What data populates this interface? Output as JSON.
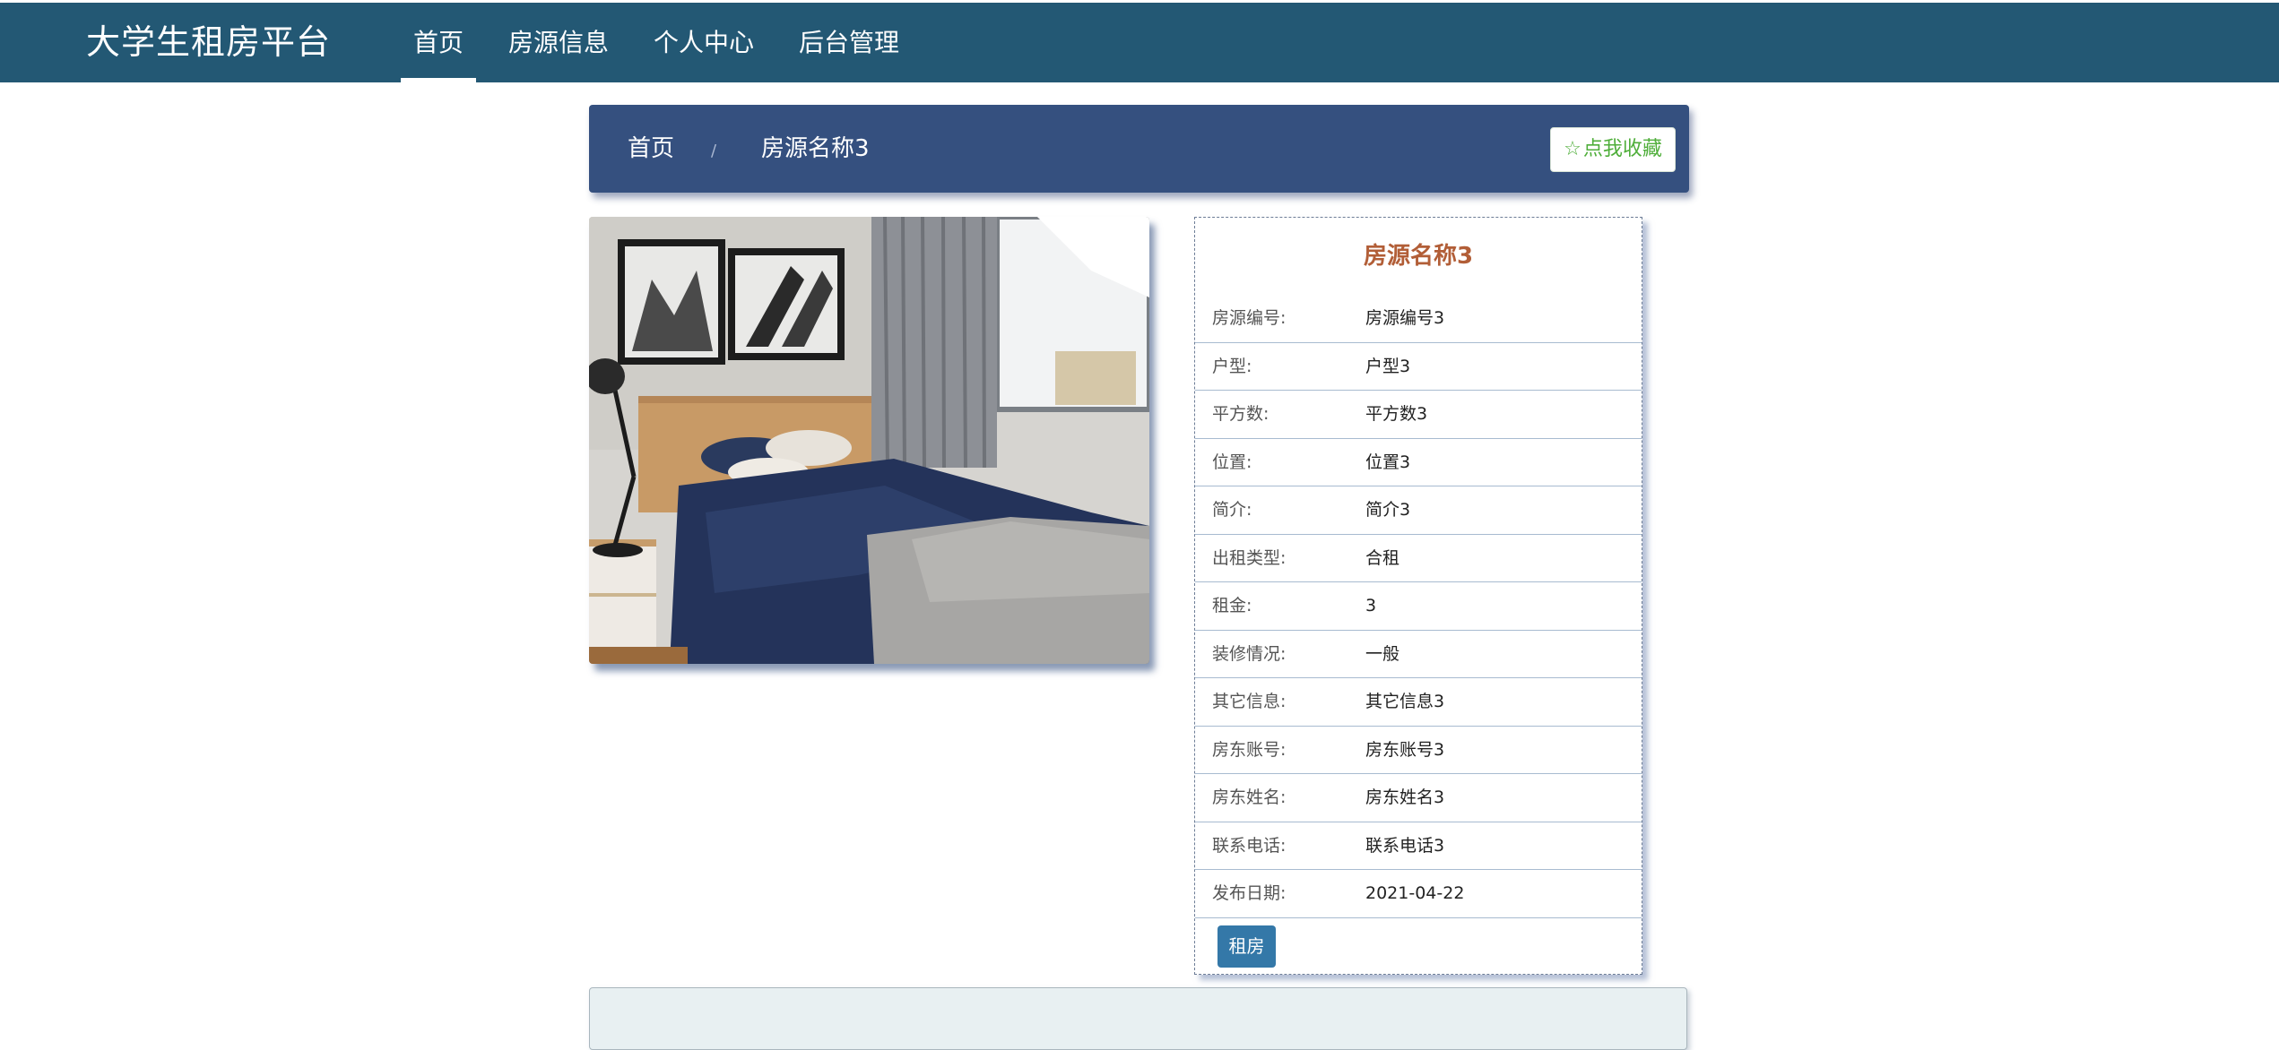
{
  "brand": "大学生租房平台",
  "nav": [
    {
      "label": "首页",
      "active": true
    },
    {
      "label": "房源信息",
      "active": false
    },
    {
      "label": "个人中心",
      "active": false
    },
    {
      "label": "后台管理",
      "active": false
    }
  ],
  "breadcrumb": {
    "home": "首页",
    "separator": "/",
    "current": "房源名称3"
  },
  "favorite_button": {
    "icon": "star-outline-icon",
    "label": "点我收藏"
  },
  "photo": {
    "description_icon": "bedroom-photo"
  },
  "detail": {
    "title": "房源名称3",
    "rows": [
      {
        "key": "房源编号:",
        "value": "房源编号3"
      },
      {
        "key": "户型:",
        "value": "户型3"
      },
      {
        "key": "平方数:",
        "value": "平方数3"
      },
      {
        "key": "位置:",
        "value": "位置3"
      },
      {
        "key": "简介:",
        "value": "简介3"
      },
      {
        "key": "出租类型:",
        "value": "合租"
      },
      {
        "key": "租金:",
        "value": "3"
      },
      {
        "key": "装修情况:",
        "value": "一般"
      },
      {
        "key": "其它信息:",
        "value": "其它信息3"
      },
      {
        "key": "房东账号:",
        "value": "房东账号3"
      },
      {
        "key": "房东姓名:",
        "value": "房东姓名3"
      },
      {
        "key": "联系电话:",
        "value": "联系电话3"
      },
      {
        "key": "发布日期:",
        "value": "2021-04-22"
      }
    ],
    "rent_button": "租房"
  },
  "colors": {
    "nav_bg": "#235874",
    "crumb_bg": "#35507f",
    "title_color": "#b25e37",
    "fav_text": "#4fae3a",
    "rent_btn": "#3478a8"
  }
}
